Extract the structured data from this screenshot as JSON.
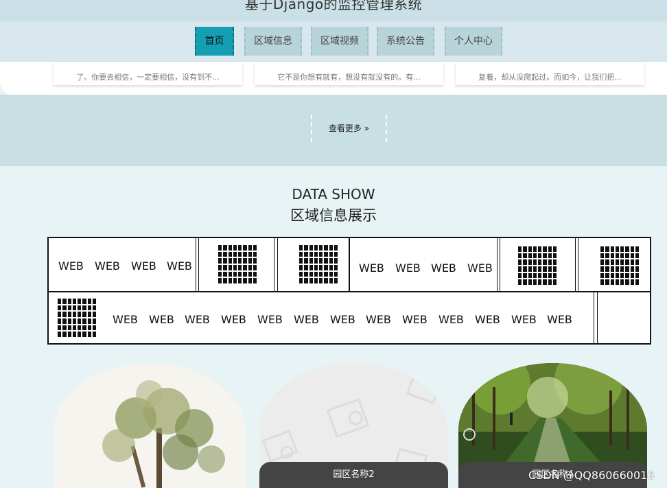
{
  "header": {
    "title": "基于Django的监控管理系统"
  },
  "nav": {
    "items": [
      {
        "label": "首页",
        "active": true
      },
      {
        "label": "区域信息"
      },
      {
        "label": "区域视频"
      },
      {
        "label": "系统公告"
      },
      {
        "label": "个人中心"
      }
    ]
  },
  "news": {
    "cards": [
      {
        "snippet": "了。你要去相信，一定要相信，没有到不..."
      },
      {
        "snippet": "它不是你想有就有，想没有就没有的。有..."
      },
      {
        "snippet": "复着，却从没爬起过。而如今，让我们把..."
      }
    ],
    "more_label": "查看更多 »"
  },
  "data_show": {
    "title_en": "DATA SHOW",
    "title_cn": "区域信息展示",
    "web_label": "WEB"
  },
  "gallery": {
    "items": [
      {
        "caption": ""
      },
      {
        "caption": "园区名称2"
      },
      {
        "caption": "园区名称4"
      }
    ]
  },
  "watermark": "CSDN @QQ860660016",
  "colors": {
    "accent": "#149fb3",
    "nav_bg": "#d8e6ee",
    "tab_bg": "#b8d4d8",
    "band_bg": "#c8dfe4",
    "page_bg": "#e8f3f6"
  }
}
